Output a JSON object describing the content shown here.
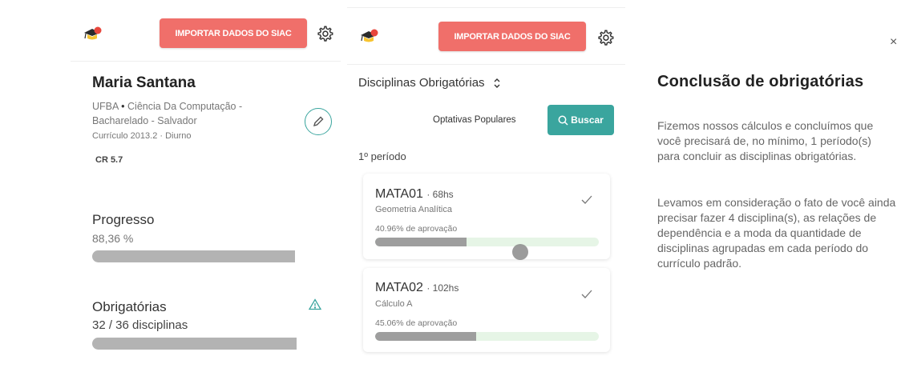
{
  "header": {
    "import_label": "IMPORTAR DADOS DO SIAC"
  },
  "profile": {
    "name": "Maria Santana",
    "university": "UFBA",
    "course_line1": "Ciência Da Computação -",
    "course_line2": "Bacharelado - Salvador",
    "curriculum": "Currículo 2013.2 · Diurno",
    "cr": "CR 5.7"
  },
  "progress": {
    "title": "Progresso",
    "value_text": "88,36 %",
    "value": 88.36
  },
  "required": {
    "title": "Obrigatórias",
    "count_text": "32 / 36 disciplinas",
    "fraction": 0.889
  },
  "disciplines": {
    "selector_label": "Disciplinas Obrigatórias",
    "popular_label": "Optativas Populares",
    "search_label": "Buscar",
    "period_label": "1º período",
    "items": [
      {
        "code": "MATA01",
        "hours": "· 68hs",
        "name": "Geometria Analítica",
        "approval_text": "40.96% de aprovação",
        "approval": 40.96
      },
      {
        "code": "MATA02",
        "hours": "· 102hs",
        "name": "Cálculo A",
        "approval_text": "45.06% de aprovação",
        "approval": 45.06
      }
    ]
  },
  "info": {
    "close_label": "×",
    "title": "Conclusão de obrigatórias",
    "paragraph1": "Fizemos nossos cálculos e concluímos que você precisará de, no mínimo, 1 período(s) para concluir as disciplinas obrigatórias.",
    "paragraph2": "Levamos em consideração o fato de você ainda precisar fazer 4 disciplina(s), as relações de dependência e a moda da quantidade de disciplinas agrupadas em cada período do currículo padrão."
  },
  "colors": {
    "import_button": "#f06f6a",
    "accent_teal": "#3aa59e",
    "bar_grey": "#b3b3b3",
    "track_green": "#e6f5e6"
  }
}
